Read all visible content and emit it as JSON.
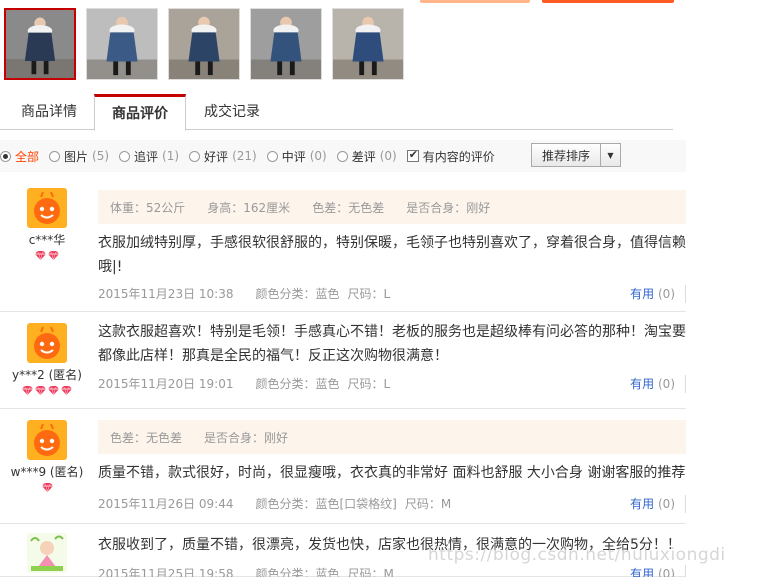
{
  "thumbnails": [
    {
      "name": "thumb-1",
      "coat": "#2a3a55",
      "bg": "#8a8a8a",
      "active": true
    },
    {
      "name": "thumb-2",
      "coat": "#3b5a85",
      "bg": "#bdbdbd",
      "active": false
    },
    {
      "name": "thumb-3",
      "coat": "#2c4466",
      "bg": "#a9a39a",
      "active": false
    },
    {
      "name": "thumb-4",
      "coat": "#34537c",
      "bg": "#9e9e9e",
      "active": false
    },
    {
      "name": "thumb-5",
      "coat": "#2e4d7c",
      "bg": "#b8b4ac",
      "active": false
    }
  ],
  "tabs": {
    "details": "商品详情",
    "reviews": "商品评价",
    "records": "成交记录"
  },
  "filters": {
    "all": {
      "label": "全部"
    },
    "pic": {
      "label": "图片",
      "count": "(5)"
    },
    "follow": {
      "label": "追评",
      "count": "(1)"
    },
    "good": {
      "label": "好评",
      "count": "(21)"
    },
    "mid": {
      "label": "中评",
      "count": "(0)"
    },
    "bad": {
      "label": "差评",
      "count": "(0)"
    },
    "has_content": {
      "label": "有内容的评价"
    },
    "sort": "推荐排序"
  },
  "reviews": [
    {
      "user": "c***华",
      "attrs": [
        "体重：52公斤",
        "身高：162厘米",
        "色差：无色差",
        "是否合身：刚好"
      ],
      "content": "衣服加绒特别厚，手感很软很舒服的，特别保暖，毛领子也特别喜欢了，穿着很合身，值得信赖哦|!",
      "date": "2015年11月23日 10:38",
      "sku_color": "颜色分类：蓝色",
      "sku_size": "尺码：L",
      "useful_label": "有用",
      "useful_count": "(0)"
    },
    {
      "user": "y***2 (匿名)",
      "attrs": [],
      "content": "这款衣服超喜欢！特别是毛领！手感真心不错！老板的服务也是超级棒有问必答的那种！淘宝要都像此店样！那真是全民的福气！反正这次购物很满意！",
      "date": "2015年11月20日 19:01",
      "sku_color": "颜色分类：蓝色",
      "sku_size": "尺码：L",
      "useful_label": "有用",
      "useful_count": "(0)"
    },
    {
      "user": "w***9 (匿名)",
      "attrs": [
        "色差：无色差",
        "是否合身：刚好"
      ],
      "content": "质量不错，款式很好，时尚，很显瘦哦，衣衣真的非常好 面料也舒服 大小合身 谢谢客服的推荐",
      "date": "2015年11月26日 09:44",
      "sku_color": "颜色分类：蓝色[口袋格纹]",
      "sku_size": "尺码：M",
      "useful_label": "有用",
      "useful_count": "(0)"
    },
    {
      "user": "",
      "attrs": [],
      "content": "衣服收到了，质量不错，很漂亮，发货也快，店家也很热情，很满意的一次购物，全给5分！！",
      "date": "2015年11月25日 19:58",
      "sku_color": "颜色分类：蓝色",
      "sku_size": "尺码：M",
      "useful_label": "有用",
      "useful_count": "(0)"
    }
  ],
  "watermark": "https://blog.csdn.net/huluxiongdi"
}
